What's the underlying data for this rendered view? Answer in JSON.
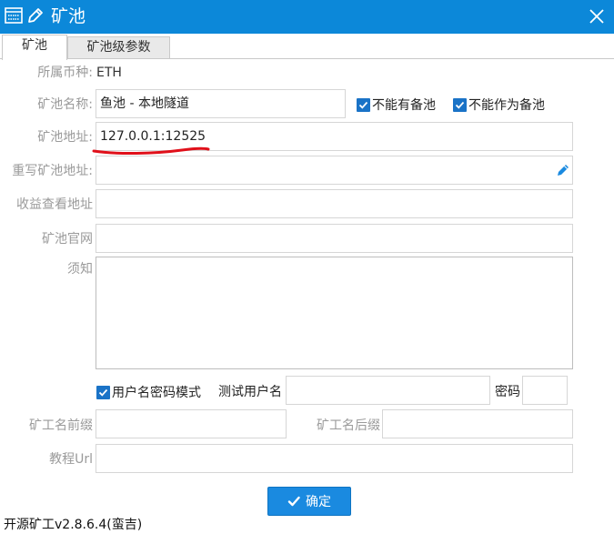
{
  "window": {
    "title": "矿池",
    "close_icon": "close-icon",
    "title_bg_color": "#0c88d9"
  },
  "tabs": [
    {
      "label": "矿池",
      "active": true
    },
    {
      "label": "矿池级参数",
      "active": false
    }
  ],
  "form": {
    "coin": {
      "label": "所属币种:",
      "value": "ETH"
    },
    "pool_name": {
      "label": "矿池名称:",
      "value": "鱼池 - 本地隧道"
    },
    "no_backup_pool": {
      "label": "不能有备池",
      "checked": true
    },
    "not_as_backup": {
      "label": "不能作为备池",
      "checked": true
    },
    "pool_address": {
      "label": "矿池地址:",
      "value": "127.0.0.1:12525"
    },
    "rewrite_address": {
      "label": "重写矿池地址:",
      "value": ""
    },
    "income_url": {
      "label": "收益查看地址",
      "value": ""
    },
    "official_site": {
      "label": "矿池官网",
      "value": ""
    },
    "notice": {
      "label": "须知",
      "value": ""
    },
    "user_pass_mode": {
      "label": "用户名密码模式",
      "checked": true
    },
    "test_username": {
      "label": "测试用户名",
      "value": ""
    },
    "password": {
      "label": "密码",
      "value": ""
    },
    "worker_prefix": {
      "label": "矿工名前缀",
      "value": ""
    },
    "worker_suffix": {
      "label": "矿工名后缀",
      "value": ""
    },
    "tutorial_url": {
      "label": "教程Url",
      "value": ""
    }
  },
  "buttons": {
    "ok_label": "确定"
  },
  "footer": {
    "version_text": "开源矿工v2.8.6.4(蛮吉)"
  },
  "colors": {
    "accent": "#1a8ae0",
    "checkbox": "#1a73c7",
    "annotation": "#e0101a"
  }
}
